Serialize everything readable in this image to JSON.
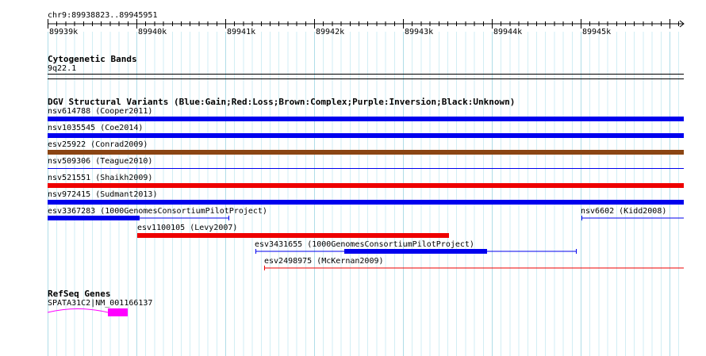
{
  "ruler": {
    "range_label": "chr9:89938823..89945951",
    "ticks": [
      "89939k",
      "89940k",
      "89941k",
      "89942k",
      "89943k",
      "89944k",
      "89945k"
    ]
  },
  "cytoband": {
    "title": "Cytogenetic Bands",
    "band_label": "9q22.1"
  },
  "dgv": {
    "title": "DGV Structural Variants (Blue:Gain;Red:Loss;Brown:Complex;Purple:Inversion;Black:Unknown)",
    "colors": {
      "gain": "#0000ee",
      "loss": "#ee0000",
      "complex": "#8b4513"
    },
    "variants": [
      {
        "label": "nsv614788 (Cooper2011)",
        "color": "gain"
      },
      {
        "label": "nsv1035545 (Coe2014)",
        "color": "gain"
      },
      {
        "label": "esv25922 (Conrad2009)",
        "color": "complex"
      },
      {
        "label": "nsv509306 (Teague2010)",
        "color": "gain"
      },
      {
        "label": "nsv521551 (Shaikh2009)",
        "color": "loss"
      },
      {
        "label": "nsv972415 (Sudmant2013)",
        "color": "gain"
      },
      {
        "label": "esv3367283 (1000GenomesConsortiumPilotProject)",
        "color": "gain"
      },
      {
        "label": "nsv6602 (Kidd2008)",
        "color": "gain"
      },
      {
        "label": "esv1100105 (Levy2007)",
        "color": "loss"
      },
      {
        "label": "esv3431655 (1000GenomesConsortiumPilotProject)",
        "color": "gain"
      },
      {
        "label": "esv2498975 (McKernan2009)",
        "color": "loss"
      }
    ]
  },
  "refseq": {
    "title": "RefSeq Genes",
    "gene_label": "SPATA31C2|NM_001166137",
    "color": "#ff00ff"
  }
}
